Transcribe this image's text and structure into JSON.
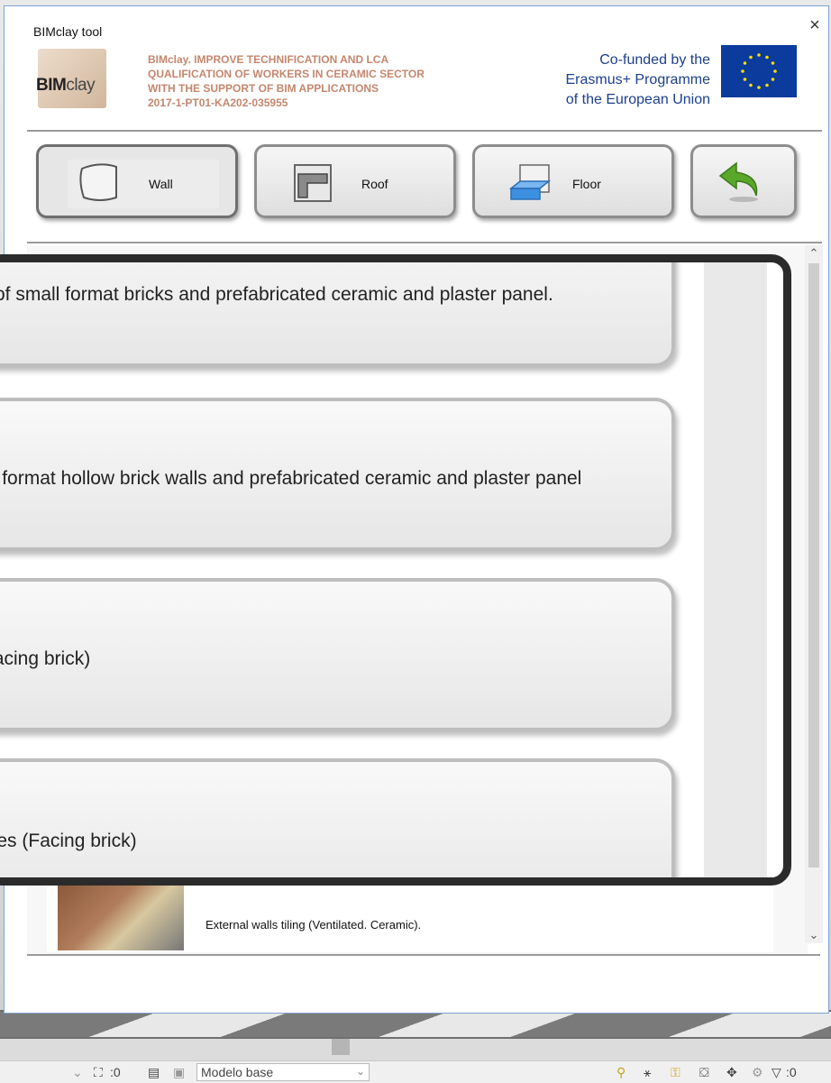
{
  "dialog": {
    "title": "BIMclay tool",
    "close_glyph": "×"
  },
  "header": {
    "logo_bold": "BIM",
    "logo_thin": "clay",
    "project_lines": [
      "BIMclay. IMPROVE TECHNIFICATION AND LCA",
      "QUALIFICATION OF WORKERS IN CERAMIC SECTOR",
      "WITH THE SUPPORT OF BIM APPLICATIONS",
      "2017-1-PT01-KA202-035955"
    ],
    "eu_lines": [
      "Co-funded by the",
      "Erasmus+ Programme",
      "of the European Union"
    ]
  },
  "toolbar": {
    "wall_label": "Wall",
    "roof_label": "Roof",
    "floor_label": "Floor",
    "back_icon": "back-arrow-icon"
  },
  "zoom_cards": [
    "ls of small format bricks and prefabricated ceramic and plaster panel.",
    "ge format hollow brick walls and prefabricated ceramic and plaster panel",
    "(Facing brick)",
    "ndes (Facing brick)"
  ],
  "list": {
    "visible_row": "External walls tiling (Ventilated. Ceramic)."
  },
  "statusbar": {
    "count_a": ":0",
    "view_select": "Modelo base",
    "filter_count": ":0"
  },
  "colors": {
    "accent_text": "#c4876e",
    "eu_blue": "#0b3b9c",
    "back_arrow": "#5aa82a"
  }
}
